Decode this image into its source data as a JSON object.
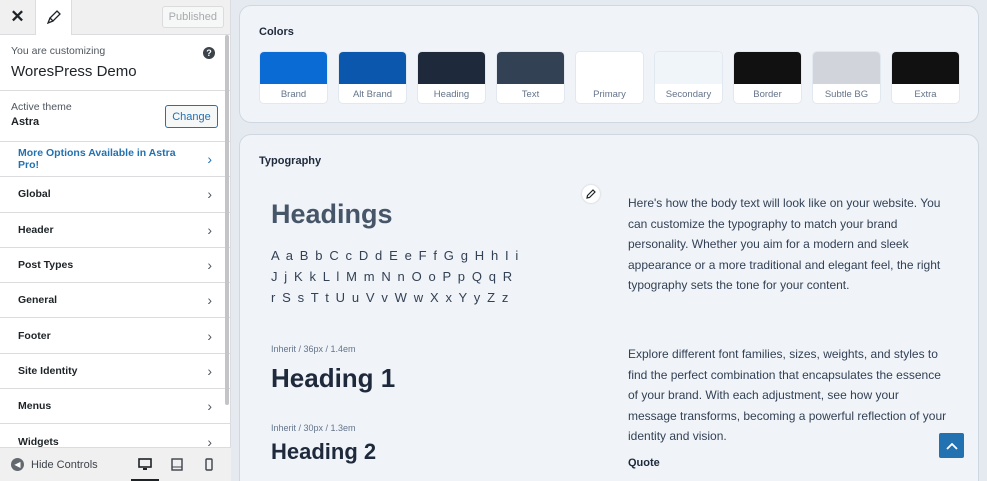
{
  "topbar": {
    "published": "Published"
  },
  "customizing": {
    "label": "You are customizing",
    "site": "WoresPress Demo"
  },
  "theme": {
    "label": "Active theme",
    "name": "Astra",
    "change": "Change"
  },
  "menu": {
    "pro": "More Options Available in Astra Pro!",
    "items": [
      "Global",
      "Header",
      "Post Types",
      "General",
      "Footer",
      "Site Identity",
      "Menus",
      "Widgets"
    ]
  },
  "bottom": {
    "hide": "Hide Controls"
  },
  "colors": {
    "title": "Colors",
    "swatches": [
      {
        "label": "Brand",
        "color": "#0b6bd5"
      },
      {
        "label": "Alt Brand",
        "color": "#0a57ad"
      },
      {
        "label": "Heading",
        "color": "#1e293b"
      },
      {
        "label": "Text",
        "color": "#334155"
      },
      {
        "label": "Primary",
        "color": "#ffffff"
      },
      {
        "label": "Secondary",
        "color": "#f0f5fa"
      },
      {
        "label": "Border",
        "color": "#111111"
      },
      {
        "label": "Subtle BG",
        "color": "#d1d5db"
      },
      {
        "label": "Extra",
        "color": "#111111"
      }
    ]
  },
  "typography": {
    "title": "Typography",
    "headings": "Headings",
    "alphabet": "A a B b C c D d E e F f G g H h I i J j K k L l M m N n O o P p Q q R r S s T t U u V v W w X x Y y Z z",
    "h1_meta": "Inherit / 36px / 1.4em",
    "h1": "Heading 1",
    "h2_meta": "Inherit / 30px / 1.3em",
    "h2": "Heading 2",
    "para1": "Here's how the body text will look like on your website. You can customize the typography to match your brand personality. Whether you aim for a modern and sleek appearance or a more traditional and elegant feel, the right typography sets the tone for your content.",
    "para2": "Explore different font families, sizes, weights, and styles to find the perfect combination that encapsulates the essence of your brand. With each adjustment, see how your message transforms, becoming a powerful reflection of your identity and vision.",
    "quote": "Quote"
  }
}
